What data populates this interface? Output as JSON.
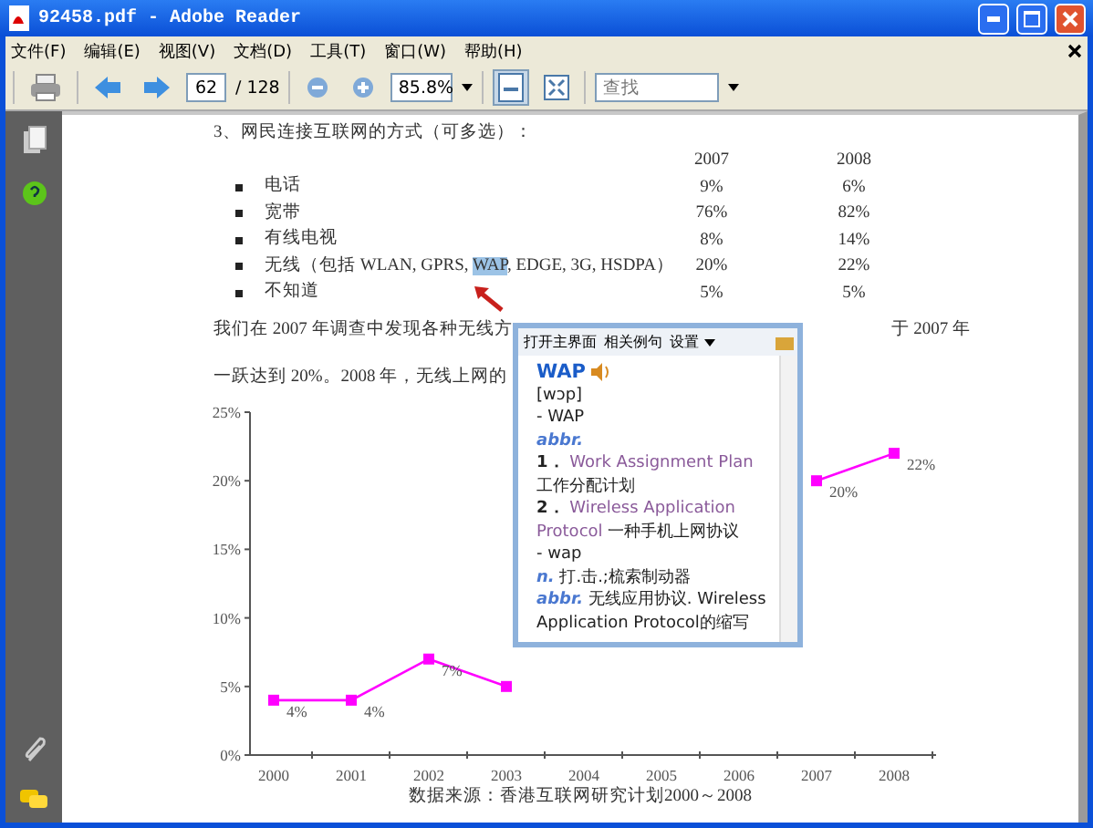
{
  "window": {
    "title": "92458.pdf - Adobe Reader"
  },
  "menu": [
    "文件(F)",
    "编辑(E)",
    "视图(V)",
    "文档(D)",
    "工具(T)",
    "窗口(W)",
    "帮助(H)"
  ],
  "toolbar": {
    "page": "62",
    "page_count": "/ 128",
    "zoom": "85.8%",
    "fit_page_selected": true,
    "search_placeholder": "查找"
  },
  "document": {
    "heading": "3、网民连接互联网的方式（可多选）：",
    "table": {
      "columns": [
        "2007",
        "2008"
      ],
      "rows": [
        {
          "segments": [
            {
              "text": "电话",
              "selected": false
            }
          ],
          "values": [
            "9%",
            "6%"
          ]
        },
        {
          "segments": [
            {
              "text": "宽带",
              "selected": false
            }
          ],
          "values": [
            "76%",
            "82%"
          ]
        },
        {
          "segments": [
            {
              "text": "有线电视",
              "selected": false
            }
          ],
          "values": [
            "8%",
            "14%"
          ]
        },
        {
          "segments": [
            {
              "text": "无线（包括 WLAN, GPRS, ",
              "selected": false
            },
            {
              "text": "WAP",
              "selected": true
            },
            {
              "text": ", EDGE, 3G, HSDPA）",
              "selected": false
            }
          ],
          "values": [
            "20%",
            "22%"
          ]
        },
        {
          "segments": [
            {
              "text": "不知道",
              "selected": false
            }
          ],
          "values": [
            "5%",
            "5%"
          ]
        }
      ]
    },
    "paragraph": [
      {
        "left": "我们在 2007 年调查中发现各种无线方",
        "right": "于 2007 年"
      },
      {
        "left": "一跃达到 20%。2008 年，无线上网的"
      }
    ],
    "chart_data": {
      "type": "line",
      "categories": [
        "2000",
        "2001",
        "2002",
        "2003",
        "2004",
        "2005",
        "2006",
        "2007",
        "2008"
      ],
      "series": [
        {
          "color": "#ff00ff",
          "marker": "square",
          "values": [
            4,
            4,
            7,
            5,
            null,
            null,
            null,
            20,
            22
          ]
        }
      ],
      "ylim": [
        0,
        25
      ],
      "yticks": [
        {
          "value": 0,
          "label": "0%"
        },
        {
          "value": 5,
          "label": "5%"
        },
        {
          "value": 10,
          "label": "10%"
        },
        {
          "value": 15,
          "label": "15%"
        },
        {
          "value": 20,
          "label": "20%"
        },
        {
          "value": 25,
          "label": "25%"
        }
      ],
      "value_labels": [
        "4%",
        "4%",
        "7%",
        null,
        null,
        null,
        null,
        "20%",
        "22%"
      ]
    },
    "chart_source": "数据来源：香港互联网研究计划2000～2008"
  },
  "popup": {
    "toolbar": [
      "打开主界面",
      "相关例句",
      "设置"
    ],
    "headword": "WAP",
    "phonetic": "[wɔp]",
    "entries": [
      {
        "kind": "form",
        "text": "- WAP"
      },
      {
        "kind": "pos",
        "text": "abbr."
      },
      {
        "kind": "sense",
        "number": "1．",
        "english": "Work Assignment Plan",
        "chinese": "工作分配计划"
      },
      {
        "kind": "sense",
        "number": "2．",
        "english": "Wireless Application Protocol",
        "chinese": "一种手机上网协议"
      },
      {
        "kind": "form",
        "text": "- wap"
      },
      {
        "kind": "def",
        "pos": "n.",
        "text": "打.击.;梳索制动器"
      },
      {
        "kind": "def",
        "pos": "abbr.",
        "text": "无线应用协议. Wireless Application Protocol的缩写"
      }
    ]
  }
}
